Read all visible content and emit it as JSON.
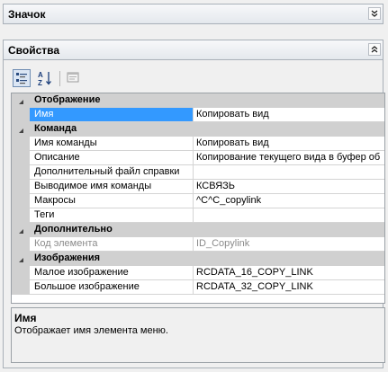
{
  "panels": {
    "icon_panel_title": "Значок",
    "properties_panel_title": "Свойства"
  },
  "grid": {
    "rows": [
      {
        "type": "category",
        "label": "Отображение"
      },
      {
        "type": "prop",
        "name": "Имя",
        "value": "Копировать вид",
        "selected": true
      },
      {
        "type": "category",
        "label": "Команда"
      },
      {
        "type": "prop",
        "name": "Имя команды",
        "value": "Копировать вид"
      },
      {
        "type": "prop",
        "name": "Описание",
        "value": "Копирование текущего вида в буфер об"
      },
      {
        "type": "prop",
        "name": "Дополнительный файл справки",
        "value": ""
      },
      {
        "type": "prop",
        "name": "Выводимое имя команды",
        "value": "КСВЯЗЬ"
      },
      {
        "type": "prop",
        "name": "Макросы",
        "value": "^C^C_copylink"
      },
      {
        "type": "prop",
        "name": "Теги",
        "value": ""
      },
      {
        "type": "category",
        "label": "Дополнительно"
      },
      {
        "type": "prop",
        "name": "Код элемента",
        "value": "ID_Copylink",
        "disabled": true
      },
      {
        "type": "category",
        "label": "Изображения"
      },
      {
        "type": "prop",
        "name": "Малое изображение",
        "value": "RCDATA_16_COPY_LINK"
      },
      {
        "type": "prop",
        "name": "Большое изображение",
        "value": "RCDATA_32_COPY_LINK"
      }
    ]
  },
  "description": {
    "title": "Имя",
    "text": "Отображает имя элемента меню."
  }
}
